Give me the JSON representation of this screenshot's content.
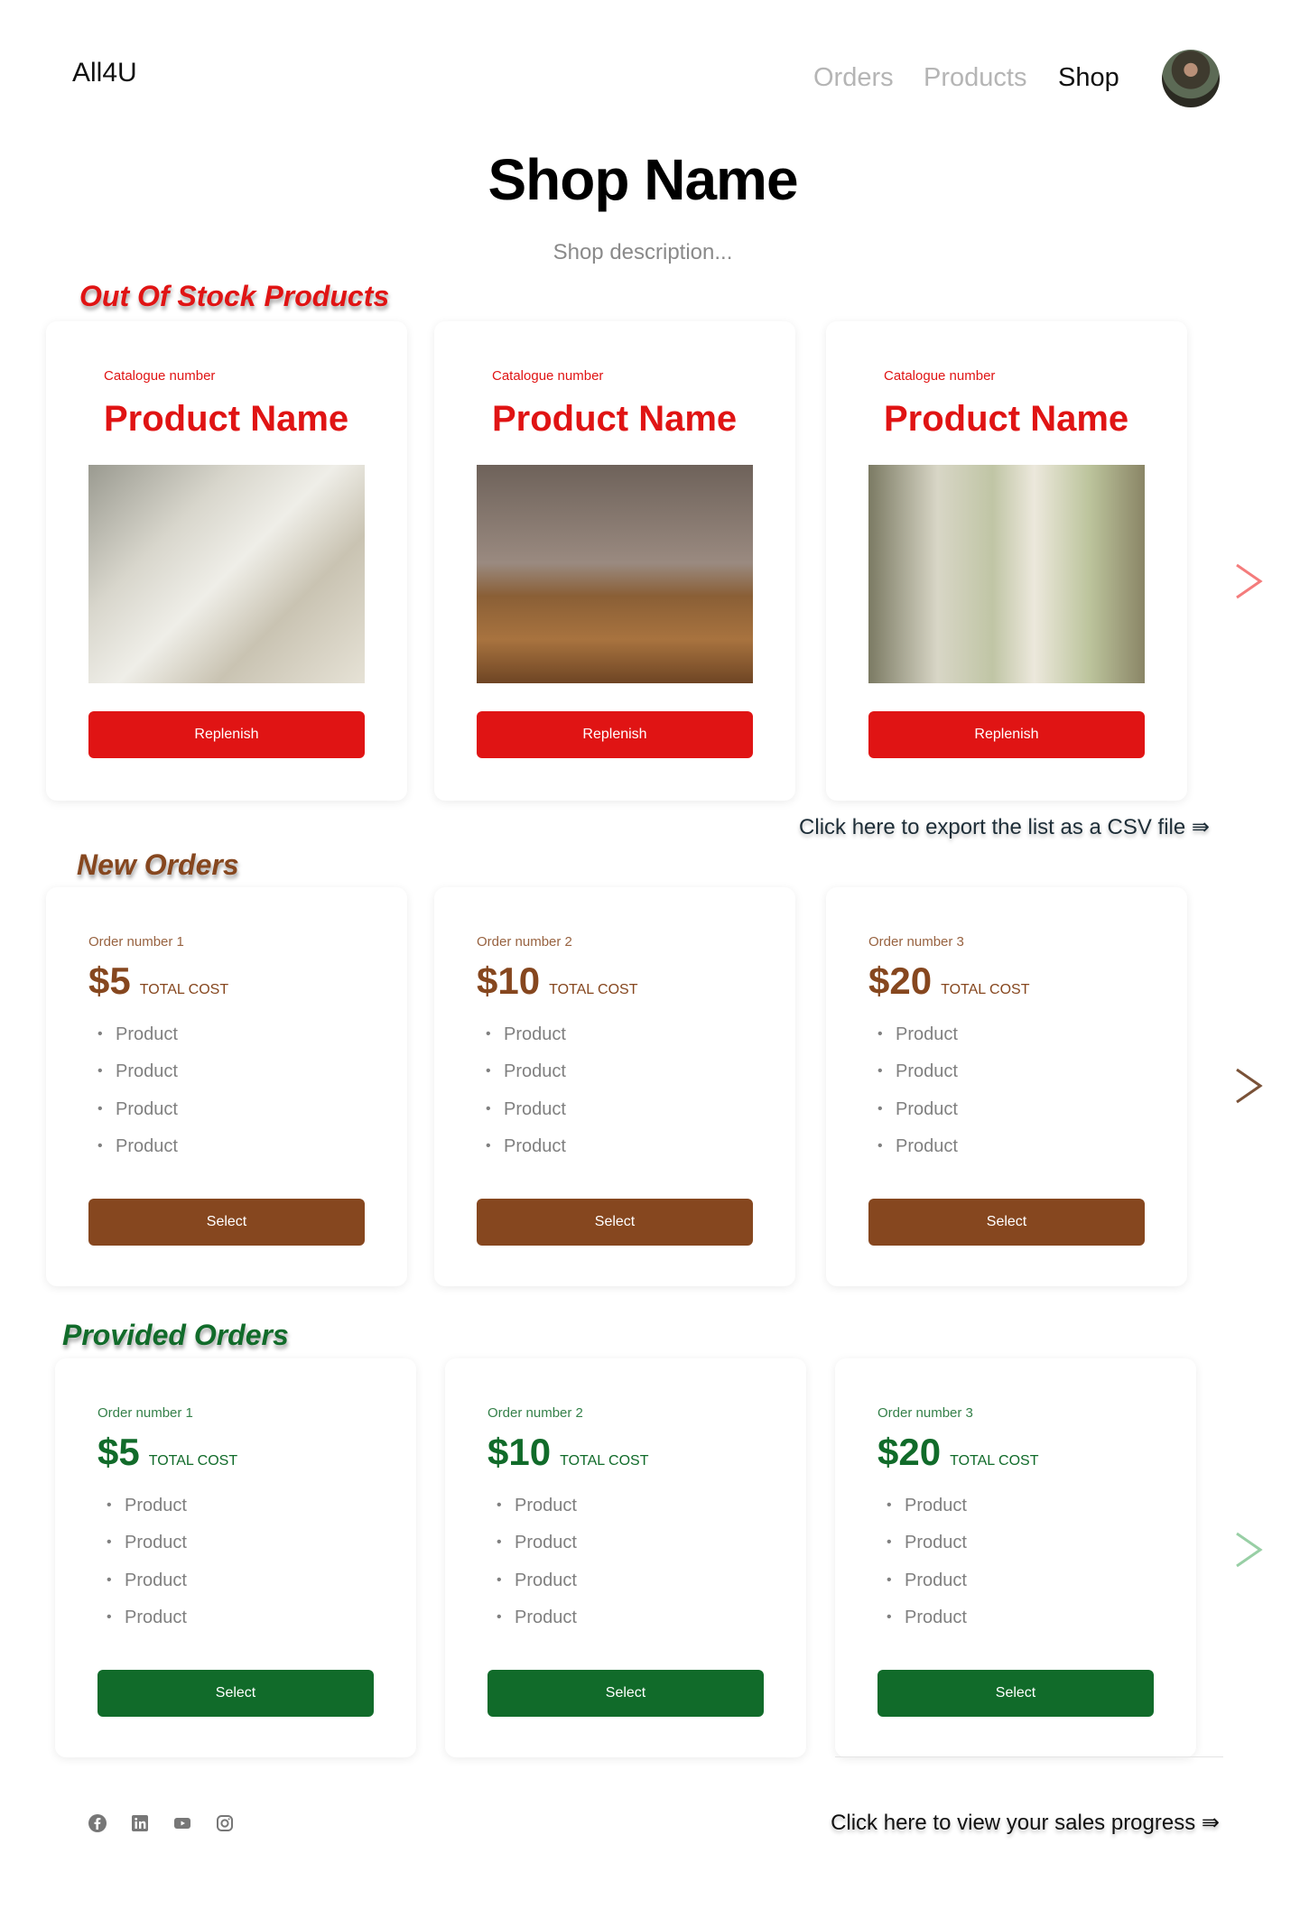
{
  "header": {
    "logo": "All4U",
    "nav": [
      {
        "label": "Orders",
        "active": false
      },
      {
        "label": "Products",
        "active": false
      },
      {
        "label": "Shop",
        "active": true
      }
    ]
  },
  "shop": {
    "title": "Shop Name",
    "description": "Shop description..."
  },
  "colors": {
    "out_of_stock": "#e01414",
    "new_orders": "#86471f",
    "provided_orders": "#116b2a"
  },
  "out_of_stock": {
    "title": "Out Of Stock Products",
    "items": [
      {
        "catalogue": "Catalogue number",
        "name": "Product Name",
        "image": "glass-jar-photo",
        "button": "Replenish"
      },
      {
        "catalogue": "Catalogue number",
        "name": "Product Name",
        "image": "glass-tumblers-photo",
        "button": "Replenish"
      },
      {
        "catalogue": "Catalogue number",
        "name": "Product Name",
        "image": "candles-photo",
        "button": "Replenish"
      }
    ],
    "export_link": "Click here to export the list as a CSV file ⇛"
  },
  "new_orders": {
    "title": "New Orders",
    "items": [
      {
        "order": "Order number 1",
        "amount": "$5",
        "label": "TOTAL COST",
        "products": [
          "Product",
          "Product",
          "Product",
          "Product"
        ],
        "button": "Select"
      },
      {
        "order": "Order number 2",
        "amount": "$10",
        "label": "TOTAL COST",
        "products": [
          "Product",
          "Product",
          "Product",
          "Product"
        ],
        "button": "Select"
      },
      {
        "order": "Order number 3",
        "amount": "$20",
        "label": "TOTAL COST",
        "products": [
          "Product",
          "Product",
          "Product",
          "Product"
        ],
        "button": "Select"
      }
    ]
  },
  "provided_orders": {
    "title": "Provided Orders",
    "items": [
      {
        "order": "Order number 1",
        "amount": "$5",
        "label": "TOTAL COST",
        "products": [
          "Product",
          "Product",
          "Product",
          "Product"
        ],
        "button": "Select"
      },
      {
        "order": "Order number 2",
        "amount": "$10",
        "label": "TOTAL COST",
        "products": [
          "Product",
          "Product",
          "Product",
          "Product"
        ],
        "button": "Select"
      },
      {
        "order": "Order number 3",
        "amount": "$20",
        "label": "TOTAL COST",
        "products": [
          "Product",
          "Product",
          "Product",
          "Product"
        ],
        "button": "Select"
      }
    ]
  },
  "footer": {
    "social": [
      "facebook-icon",
      "linkedin-icon",
      "youtube-icon",
      "instagram-icon"
    ],
    "sales_link": "Click here to view your sales progress ⇛"
  }
}
